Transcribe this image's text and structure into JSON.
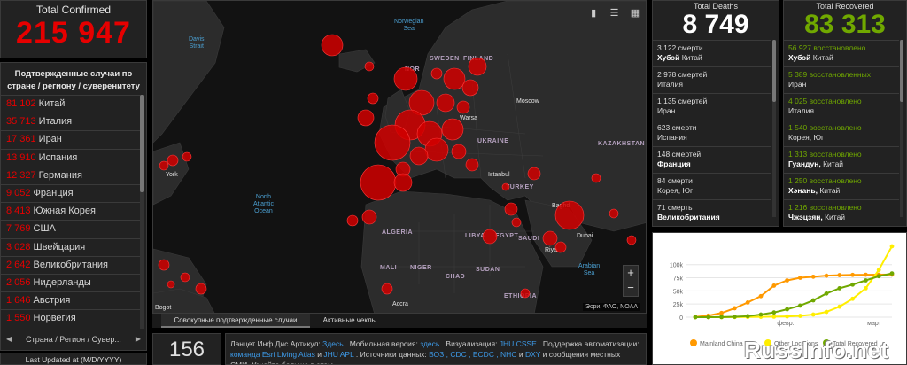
{
  "total_confirmed": {
    "label": "Total Confirmed",
    "value": "215 947"
  },
  "country_panel": {
    "header": "Подтвержденные случаи по стране / региону / суверенитету",
    "items": [
      {
        "value": "81 102",
        "name": "Китай"
      },
      {
        "value": "35 713",
        "name": "Италия"
      },
      {
        "value": "17 361",
        "name": "Иран"
      },
      {
        "value": "13 910",
        "name": "Испания"
      },
      {
        "value": "12 327",
        "name": "Германия"
      },
      {
        "value": "9 052",
        "name": "Франция"
      },
      {
        "value": "8 413",
        "name": "Южная Корея"
      },
      {
        "value": "7 769",
        "name": "США"
      },
      {
        "value": "3 028",
        "name": "Швейцария"
      },
      {
        "value": "2 642",
        "name": "Великобритания"
      },
      {
        "value": "2 056",
        "name": "Нидерланды"
      },
      {
        "value": "1 646",
        "name": "Австрия"
      },
      {
        "value": "1 550",
        "name": "Норвегия"
      }
    ],
    "nav_label": "Страна / Регион / Сувер...",
    "prev_icon": "◀",
    "next_icon": "▶"
  },
  "last_updated": "Last Updated at (M/D/YYYY)",
  "map": {
    "ocean_labels": {
      "davis": "Davis\nStrait",
      "norwegian": "Norwegian\nSea",
      "north_atlantic": "North\nAtlantic\nOcean",
      "arabian": "Arabian\nSea"
    },
    "cities": {
      "york": "York",
      "moscow": "Moscow",
      "istanbul": "Istanbul",
      "dubai": "Dubai",
      "accra": "Accra",
      "bogota": "Bogot",
      "warsaw": "Warsa",
      "baghdad": "Baghd",
      "riyadh": "Riya"
    },
    "countries": {
      "sweden": "SWEDEN",
      "finland": "FINLAND",
      "ukraine": "UKRAINE",
      "kazakhstan": "KAZAKHSTAN",
      "turkey": "TURKEY",
      "algeria": "ALGERIA",
      "libya": "LIBYA",
      "egypt": "EGYPT",
      "saudi": "SAUDI",
      "mali": "MALI",
      "niger": "NIGER",
      "chad": "CHAD",
      "sudan": "SUDAN",
      "ethiopia": "ETHIOPIA",
      "norway": "NOR",
      "iran": "IR",
      "no_short": "NO"
    },
    "attribution": "Эсри, ФАО, NOAA",
    "zoom_in": "+",
    "zoom_out": "−",
    "tool_icons": [
      "bookmark-icon",
      "list-icon",
      "grid-icon"
    ]
  },
  "map_tabs": {
    "cumulative": "Совокупные подтвержденные случаи",
    "active": "Активные чеклы"
  },
  "bottom": {
    "count": "156",
    "text_pre1": "Ланцет Инф Дис Артикул: ",
    "link_here1": "Здесь",
    "text_mid1": " . Мобильная версия: ",
    "link_here2": "здесь",
    "text_mid2": " . Визуализация: ",
    "link_jhu": "JHU CSSE",
    "text_mid3": " . Поддержка автоматизации: ",
    "link_esri": "команда Esri Living Atlas",
    "text_and": " и ",
    "link_jhuapl": "JHU APL",
    "text_mid4": " . Источники данных: ",
    "link_sources": "ВОЗ , CDC , ECDC , NHC",
    "text_and2": " и ",
    "link_dxy": "DXY",
    "text_end": " и сообщения местных СМИ. Узнайте больше в этом"
  },
  "deaths": {
    "label": "Total Deaths",
    "value": "8 749",
    "items": [
      {
        "count": "3 122  смерти",
        "place_bold": "Хубэй",
        "place": "Китай"
      },
      {
        "count": "2 978  смертей",
        "place_bold": "",
        "place": "Италия"
      },
      {
        "count": "1 135  смертей",
        "place_bold": "",
        "place": "Иран"
      },
      {
        "count": "623  смерти",
        "place_bold": "",
        "place": "Испания"
      },
      {
        "count": "148  смертей",
        "place_bold": "Франция",
        "place": "Франция"
      },
      {
        "count": "84  смерти",
        "place_bold": "",
        "place": "Корея, Юг"
      },
      {
        "count": "71  смерть",
        "place_bold": "Великобритания",
        "place": "Великобритания"
      }
    ]
  },
  "recovered": {
    "label": "Total Recovered",
    "value": "83 313",
    "items": [
      {
        "count": "56 927 восстановлено",
        "place_bold": "Хубэй",
        "place": "Китай"
      },
      {
        "count": "5 389 восстановленных",
        "place_bold": "",
        "place": "Иран"
      },
      {
        "count": "4 025 восстановлено",
        "place_bold": "",
        "place": "Италия"
      },
      {
        "count": "1 540 восстановлено",
        "place_bold": "",
        "place": "Корея, Юг"
      },
      {
        "count": "1 313 восстановлено",
        "place_bold": "Гуандун,",
        "place": "Китай"
      },
      {
        "count": "1 250 восстановлено",
        "place_bold": "Хэнань,",
        "place": "Китай"
      },
      {
        "count": "1 216 восстановлено",
        "place_bold": "Чжэцзян,",
        "place": "Китай"
      }
    ]
  },
  "chart_data": {
    "type": "line",
    "y_ticks": [
      "0",
      "25k",
      "50k",
      "75k",
      "100k"
    ],
    "ylim": [
      0,
      140000
    ],
    "x_ticks": [
      "февр.",
      "март"
    ],
    "legend": [
      "Mainland China",
      "Other Locations",
      "Total Recovered"
    ],
    "colors": {
      "mainland": "#ff9900",
      "other": "#ffee00",
      "recovered": "#70a800"
    },
    "series": [
      {
        "name": "Mainland China",
        "values": [
          500,
          3000,
          8000,
          17000,
          28000,
          40000,
          60000,
          70000,
          75000,
          77000,
          79000,
          80000,
          80500,
          80800,
          81000,
          81100
        ]
      },
      {
        "name": "Other Locations",
        "values": [
          0,
          50,
          100,
          300,
          500,
          700,
          1000,
          1500,
          2500,
          5000,
          10000,
          20000,
          35000,
          55000,
          90000,
          135000
        ]
      },
      {
        "name": "Total Recovered",
        "values": [
          0,
          30,
          200,
          800,
          2000,
          5000,
          9000,
          15000,
          22000,
          32000,
          45000,
          55000,
          62000,
          70000,
          78000,
          83313
        ]
      }
    ]
  },
  "watermark": "RussInfo.net"
}
